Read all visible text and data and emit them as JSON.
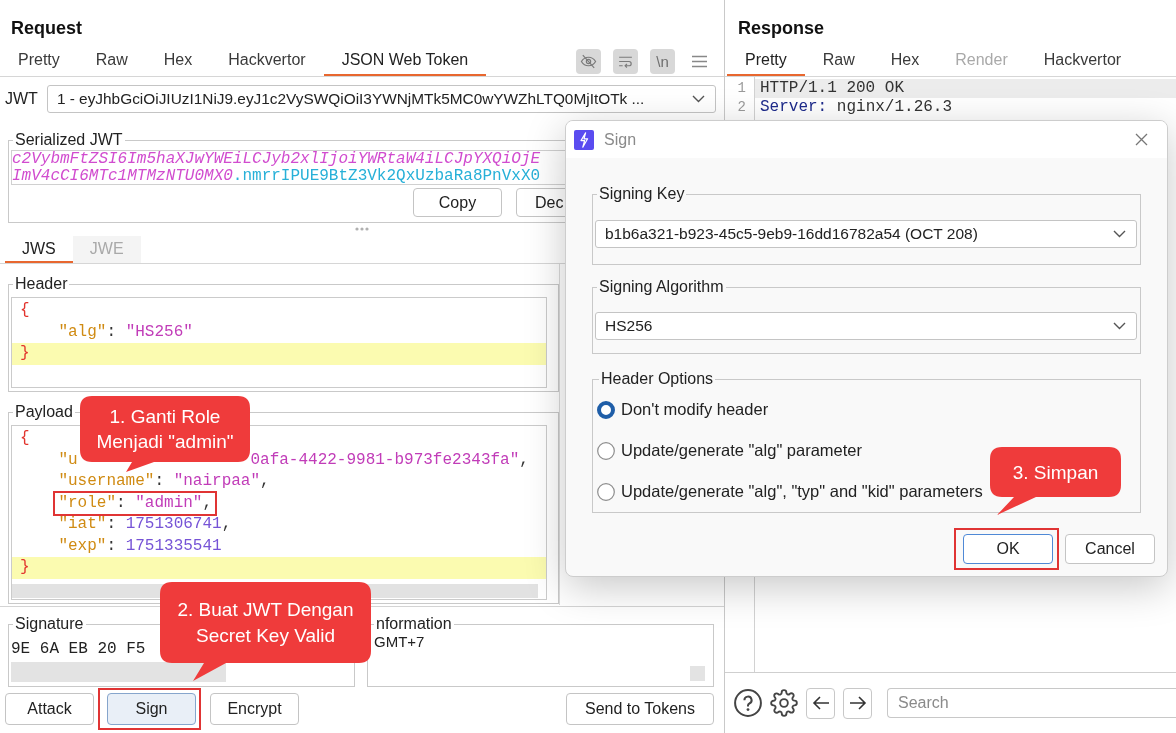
{
  "request": {
    "title": "Request",
    "tabs": [
      {
        "label": "Pretty",
        "selected": false
      },
      {
        "label": "Raw",
        "selected": false
      },
      {
        "label": "Hex",
        "selected": false
      },
      {
        "label": "Hackvertor",
        "selected": false
      },
      {
        "label": "JSON Web Token",
        "selected": true
      }
    ],
    "tools": {
      "newline_toggle": "\\n"
    },
    "jwt": {
      "label": "JWT",
      "value": "1 - eyJhbGciOiJIUzI1NiJ9.eyJ1c2VySWQiOiI3YWNjMTk5MC0wYWZhLTQ0MjItOTk ..."
    },
    "serialized_jwt": {
      "label": "Serialized JWT",
      "lines": [
        [
          {
            "kind": "payload",
            "text": "c2VybmFtZSI6Im5haXJwYWEiLCJyb2xlIjoiYWRtaW4iLCJpYXQiOjE"
          }
        ],
        [
          {
            "kind": "payload",
            "text": "ImV4cCI6MTc1MTMzNTU0MX0"
          },
          {
            "kind": "signature",
            "text": ".nmrrIPUE9BtZ3Vk2QxUzbaRa8PnVxX0"
          }
        ]
      ],
      "buttons": [
        "Copy",
        "Dec"
      ]
    },
    "token_tabs": [
      {
        "label": "JWS",
        "selected": true,
        "disabled": false
      },
      {
        "label": "JWE",
        "selected": false,
        "disabled": true
      }
    ],
    "header": {
      "label": "Header",
      "lines": [
        {
          "tokens": [
            {
              "kind": "punct",
              "text": "{"
            }
          ],
          "highlighted": false,
          "boxed": false,
          "children": [
            {
              "tokens": [
                {
                  "kind": "key",
                  "text": "\"alg\""
                },
                {
                  "kind": "plain",
                  "text": ": "
                },
                {
                  "kind": "string",
                  "text": "\"HS256\""
                }
              ],
              "highlighted": false,
              "boxed": false
            }
          ]
        },
        {
          "tokens": [
            {
              "kind": "punct",
              "text": "}"
            }
          ],
          "highlighted": true,
          "boxed": false
        }
      ]
    },
    "payload": {
      "label": "Payload",
      "lines": [
        {
          "tokens": [
            {
              "kind": "punct",
              "text": "{"
            }
          ],
          "highlighted": false,
          "boxed": false,
          "children": [
            {
              "fragments": [
                [
                  {
                    "kind": "key",
                    "text": "\"u"
                  }
                ],
                [
                  {
                    "kind": "string",
                    "text": "0afa-4422-9981-b973fe2343fa\""
                  },
                  {
                    "kind": "plain",
                    "text": ","
                  }
                ]
              ],
              "highlighted": false,
              "boxed": false
            },
            {
              "tokens": [
                {
                  "kind": "key",
                  "text": "\"username\""
                },
                {
                  "kind": "plain",
                  "text": ": "
                },
                {
                  "kind": "string",
                  "text": "\"nairpaa\""
                },
                {
                  "kind": "plain",
                  "text": ","
                }
              ],
              "highlighted": false,
              "boxed": false
            },
            {
              "tokens": [
                {
                  "kind": "key",
                  "text": "\"role\""
                },
                {
                  "kind": "plain",
                  "text": ": "
                },
                {
                  "kind": "string",
                  "text": "\"admin\""
                },
                {
                  "kind": "plain",
                  "text": ","
                }
              ],
              "highlighted": false,
              "boxed": true
            },
            {
              "tokens": [
                {
                  "kind": "key",
                  "text": "\"iat\""
                },
                {
                  "kind": "plain",
                  "text": ": "
                },
                {
                  "kind": "number",
                  "text": "1751306741"
                },
                {
                  "kind": "plain",
                  "text": ","
                }
              ],
              "highlighted": false,
              "boxed": false
            },
            {
              "tokens": [
                {
                  "kind": "key",
                  "text": "\"exp\""
                },
                {
                  "kind": "plain",
                  "text": ": "
                },
                {
                  "kind": "number",
                  "text": "1751335541"
                }
              ],
              "highlighted": false,
              "boxed": false
            }
          ]
        },
        {
          "tokens": [
            {
              "kind": "punct",
              "text": "}"
            }
          ],
          "highlighted": true,
          "boxed": false
        }
      ]
    },
    "signature": {
      "label": "Signature",
      "value": "9E 6A EB 20 F5"
    },
    "information": {
      "label": "nformation",
      "value": "GMT+7"
    },
    "buttons": [
      {
        "label": "Attack",
        "focused": false,
        "boxed": false
      },
      {
        "label": "Sign",
        "focused": true,
        "boxed": true
      },
      {
        "label": "Encrypt",
        "focused": false,
        "boxed": false
      },
      {
        "label": "Send to Tokens",
        "focused": false,
        "boxed": false
      }
    ]
  },
  "response": {
    "title": "Response",
    "tabs": [
      {
        "label": "Pretty",
        "selected": true,
        "disabled": false
      },
      {
        "label": "Raw",
        "selected": false,
        "disabled": false
      },
      {
        "label": "Hex",
        "selected": false,
        "disabled": false
      },
      {
        "label": "Render",
        "selected": false,
        "disabled": true
      },
      {
        "label": "Hackvertor",
        "selected": false,
        "disabled": false
      }
    ],
    "lines": [
      {
        "number": "1",
        "tokens": [
          {
            "kind": "plain",
            "text": "HTTP/1.1 200 OK"
          }
        ],
        "highlighted": true
      },
      {
        "number": "2",
        "tokens": [
          {
            "kind": "header_name",
            "text": "Server:"
          },
          {
            "kind": "plain",
            "text": " nginx/1.26.3"
          }
        ],
        "highlighted": false
      }
    ],
    "search": {
      "placeholder": "Search"
    }
  },
  "dialog": {
    "title": "Sign",
    "signing_key": {
      "label": "Signing Key",
      "value": "b1b6a321-b923-45c5-9eb9-16dd16782a54 (OCT 208)"
    },
    "signing_algorithm": {
      "label": "Signing Algorithm",
      "value": "HS256"
    },
    "header_options": {
      "label": "Header Options",
      "options": [
        {
          "label": "Don't modify header",
          "selected": true
        },
        {
          "label": "Update/generate \"alg\" parameter",
          "selected": false
        },
        {
          "label": "Update/generate \"alg\", \"typ\" and \"kid\" parameters",
          "selected": false
        }
      ]
    },
    "buttons": [
      {
        "label": "OK",
        "focused": true,
        "boxed": true
      },
      {
        "label": "Cancel",
        "focused": false,
        "boxed": false
      }
    ]
  },
  "callouts": [
    {
      "text": "1. Ganti Role\nMenjadi \"admin\""
    },
    {
      "text": "2. Buat JWT Dengan\nSecret Key Valid"
    },
    {
      "text": "3. Simpan"
    }
  ]
}
